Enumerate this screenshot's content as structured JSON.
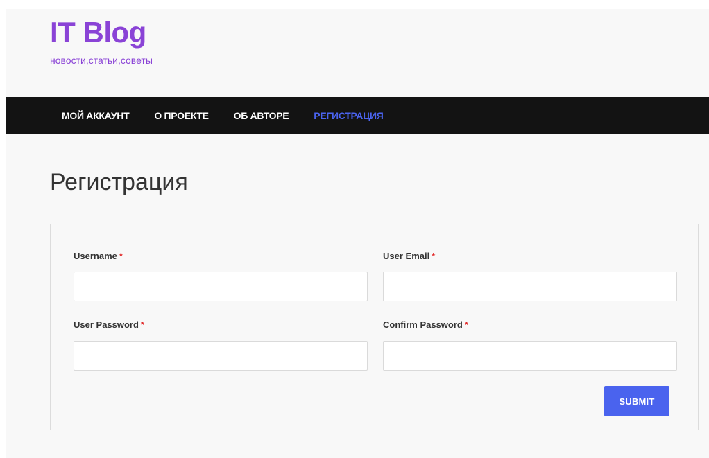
{
  "header": {
    "site_title": "IT Blog",
    "tagline": "новости,статьи,советы"
  },
  "nav": {
    "items": [
      {
        "label": "МОЙ АККАУНТ",
        "active": false
      },
      {
        "label": "О ПРОЕКТЕ",
        "active": false
      },
      {
        "label": "ОБ АВТОРЕ",
        "active": false
      },
      {
        "label": "РЕГИСТРАЦИЯ",
        "active": true
      }
    ]
  },
  "main": {
    "page_title": "Регистрация"
  },
  "form": {
    "required_mark": "*",
    "fields": [
      {
        "label": "Username",
        "value": "",
        "placeholder": ""
      },
      {
        "label": "User Email",
        "value": "",
        "placeholder": ""
      },
      {
        "label": "User Password",
        "value": "",
        "placeholder": ""
      },
      {
        "label": "Confirm Password",
        "value": "",
        "placeholder": ""
      }
    ],
    "submit_label": "SUBMIT"
  },
  "colors": {
    "brand": "#8a43d6",
    "accent": "#4a63ee",
    "nav_background": "#131313",
    "required": "#e22b2b"
  }
}
